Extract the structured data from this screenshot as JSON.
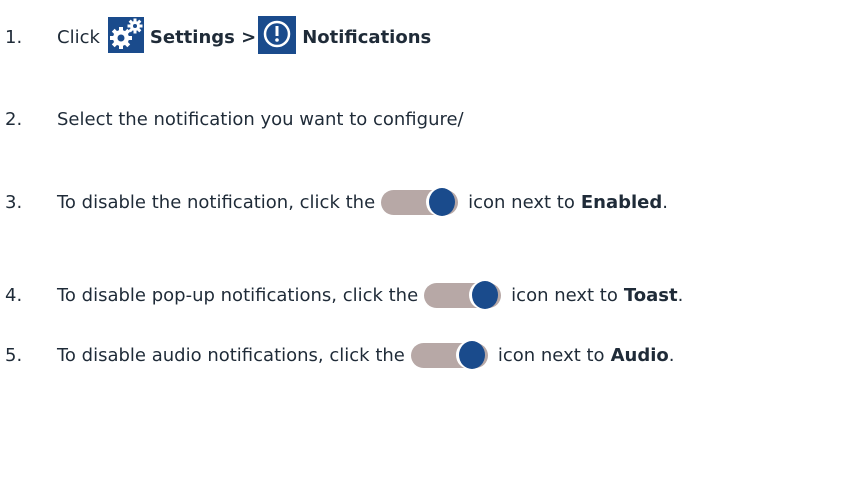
{
  "steps": [
    {
      "number": "1.",
      "click_text": "Click",
      "settings_label": "Settings >",
      "notifications_label": "Notifications",
      "settings_icon": "gears-icon",
      "notifications_icon": "exclamation-circle-icon"
    },
    {
      "number": "2.",
      "text": "Select the notification you want to configure/"
    },
    {
      "number": "3.",
      "text_before": "To disable the notification, click the",
      "text_after": "icon next to",
      "target": "Enabled",
      "end": ".",
      "toggle_icon": "toggle-on-icon"
    },
    {
      "number": "4.",
      "text_before": "To disable pop-up notifications, click the",
      "text_after": "icon next to",
      "target": "Toast",
      "end": ".",
      "toggle_icon": "toggle-on-icon"
    },
    {
      "number": "5.",
      "text_before": "To disable audio notifications, click the",
      "text_after": "icon next to",
      "target": "Audio",
      "end": ".",
      "toggle_icon": "toggle-on-icon"
    }
  ],
  "colors": {
    "text": "#1f2b38",
    "icon_blue": "#1a4b8c",
    "toggle_track": "#b7a8a6"
  }
}
